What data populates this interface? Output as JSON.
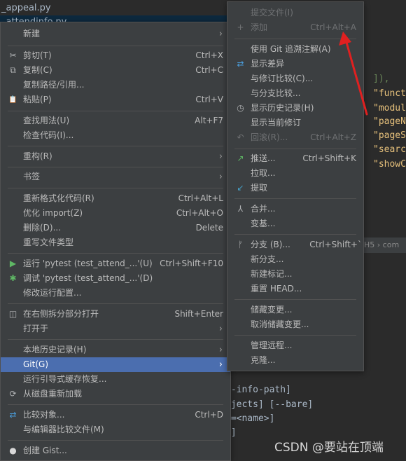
{
  "background": {
    "file_tabs": [
      "_appeal.py",
      "_attendinfo.py"
    ],
    "code_lines": [
      "]),",
      "\"funct",
      "\"modul",
      "\"pageN",
      "\"pageS",
      "\"searc",
      "\"showC"
    ],
    "tab_strip": "H5 › com",
    "terminal_lines": [
      "--info-path]",
      "ojects] [--bare]",
      "e=<name>]",
      ">]"
    ],
    "watermark": "CSDN @要站在顶端"
  },
  "context_menu": {
    "items": [
      {
        "label": "新建",
        "arrow": "›"
      },
      {
        "label": "剪切(T)",
        "icon": "✂",
        "shortcut": "Ctrl+X"
      },
      {
        "label": "复制(C)",
        "icon": "⧉",
        "shortcut": "Ctrl+C"
      },
      {
        "label": "复制路径/引用..."
      },
      {
        "label": "粘贴(P)",
        "icon": "📋",
        "shortcut": "Ctrl+V"
      },
      {
        "label": "查找用法(U)",
        "shortcut": "Alt+F7"
      },
      {
        "label": "检查代码(I)..."
      },
      {
        "label": "重构(R)",
        "arrow": "›"
      },
      {
        "label": "书签",
        "arrow": "›"
      },
      {
        "label": "重新格式化代码(R)",
        "shortcut": "Ctrl+Alt+L"
      },
      {
        "label": "优化 import(Z)",
        "shortcut": "Ctrl+Alt+O"
      },
      {
        "label": "删除(D)...",
        "shortcut": "Delete"
      },
      {
        "label": "重写文件类型"
      },
      {
        "label": "运行 'pytest (test_attend_...'(U)",
        "icon": "▶",
        "shortcut": "Ctrl+Shift+F10"
      },
      {
        "label": "调试 'pytest (test_attend_...'(D)",
        "icon": "✱",
        "shortcut": ""
      },
      {
        "label": "修改运行配置..."
      },
      {
        "label": "在右侧拆分部分打开",
        "icon": "◫",
        "shortcut": "Shift+Enter"
      },
      {
        "label": "打开于",
        "arrow": "›"
      },
      {
        "label": "本地历史记录(H)",
        "arrow": "›"
      },
      {
        "label": "Git(G)",
        "arrow": "›"
      },
      {
        "label": "运行引导式缓存恢复..."
      },
      {
        "label": "从磁盘重新加载",
        "icon": "⟳"
      },
      {
        "label": "比较对象...",
        "icon": "⇄",
        "shortcut": "Ctrl+D"
      },
      {
        "label": "与编辑器比较文件(M)"
      },
      {
        "label": "创建 Gist...",
        "icon": "●"
      }
    ]
  },
  "git_menu": {
    "items": [
      {
        "label": "提交文件(I)"
      },
      {
        "label": "添加",
        "icon": "+",
        "shortcut": "Ctrl+Alt+A"
      },
      {
        "label": "使用 Git 追溯注解(A)"
      },
      {
        "label": "显示差异",
        "icon": "⇄"
      },
      {
        "label": "与修订比较(C)..."
      },
      {
        "label": "与分支比较..."
      },
      {
        "label": "显示历史记录(H)",
        "icon": "◷"
      },
      {
        "label": "显示当前修订"
      },
      {
        "label": "回滚(R)...",
        "icon": "↶",
        "shortcut": "Ctrl+Alt+Z"
      },
      {
        "label": "推送...",
        "icon": "↗",
        "shortcut": "Ctrl+Shift+K"
      },
      {
        "label": "拉取..."
      },
      {
        "label": "提取",
        "icon": "↙"
      },
      {
        "label": "合并...",
        "icon": "⅄"
      },
      {
        "label": "变基..."
      },
      {
        "label": "分支 (B)...",
        "icon": "ᚠ",
        "shortcut": "Ctrl+Shift+`"
      },
      {
        "label": "新分支..."
      },
      {
        "label": "新建标记..."
      },
      {
        "label": "重置 HEAD..."
      },
      {
        "label": "储藏变更..."
      },
      {
        "label": "取消储藏变更..."
      },
      {
        "label": "管理远程..."
      },
      {
        "label": "克隆..."
      }
    ]
  }
}
